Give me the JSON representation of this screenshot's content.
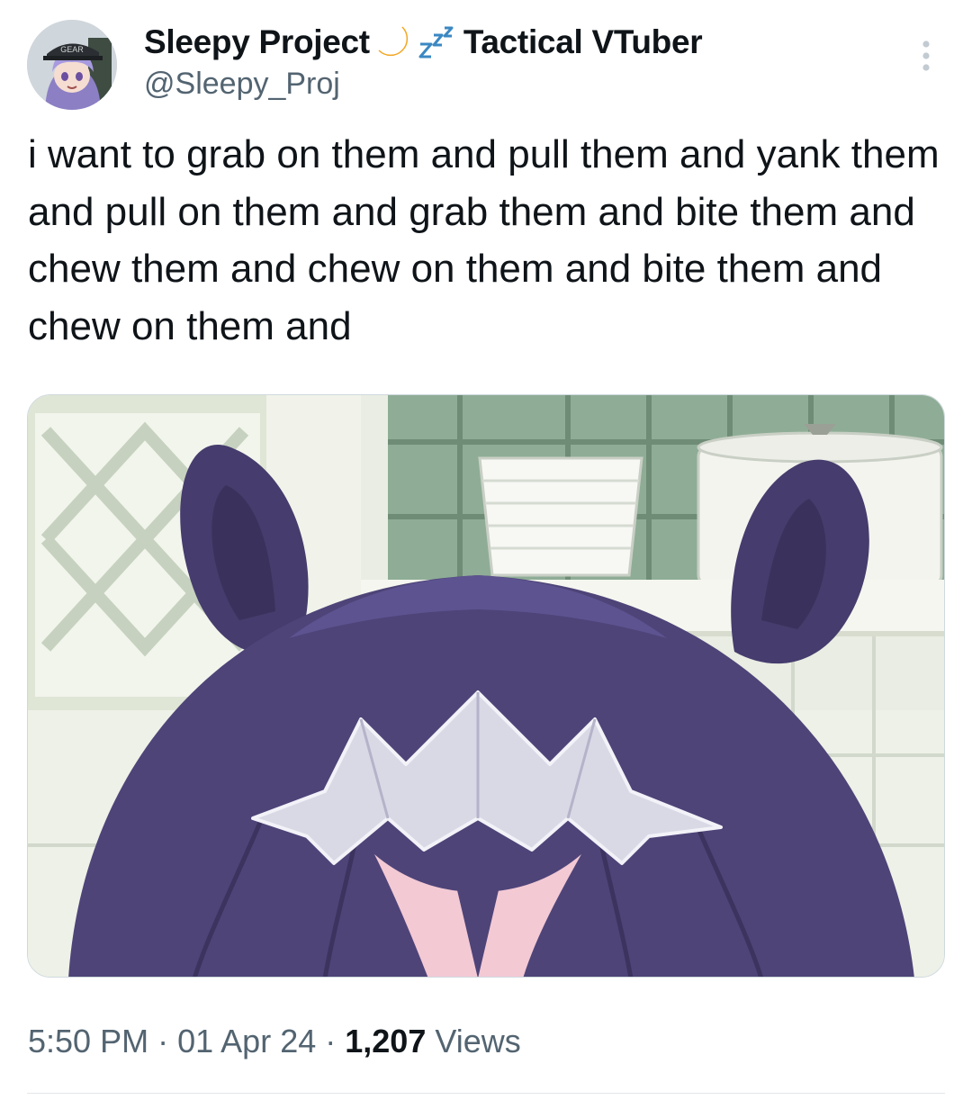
{
  "tweet": {
    "author": {
      "display_name": "Sleepy Project",
      "display_name_suffix": "Tactical VTuber",
      "handle": "@Sleepy_Proj",
      "name_emojis": [
        "crescent-moon-emoji",
        "zzz-emoji"
      ],
      "avatar_cap_text": "GEAR"
    },
    "text": "i want to grab on them and pull them and yank them and pull on them and grab them and bite them and chew them and chew on them and bite them and chew on them and",
    "media": {
      "kind": "anime-screenshot",
      "subject": "top of purple-haired character's head with horn-like ears and star-shaped hairpiece"
    },
    "meta": {
      "time": "5:50 PM",
      "separator": "·",
      "date": "01 Apr 24",
      "views_count": "1,207",
      "views_label": "Views"
    }
  },
  "icons": {
    "more": "more-vertical-icon"
  },
  "colors": {
    "text_primary": "#0f1419",
    "text_secondary": "#536471",
    "hair_purple": "#4e4478",
    "tile_green": "#8fad96"
  }
}
